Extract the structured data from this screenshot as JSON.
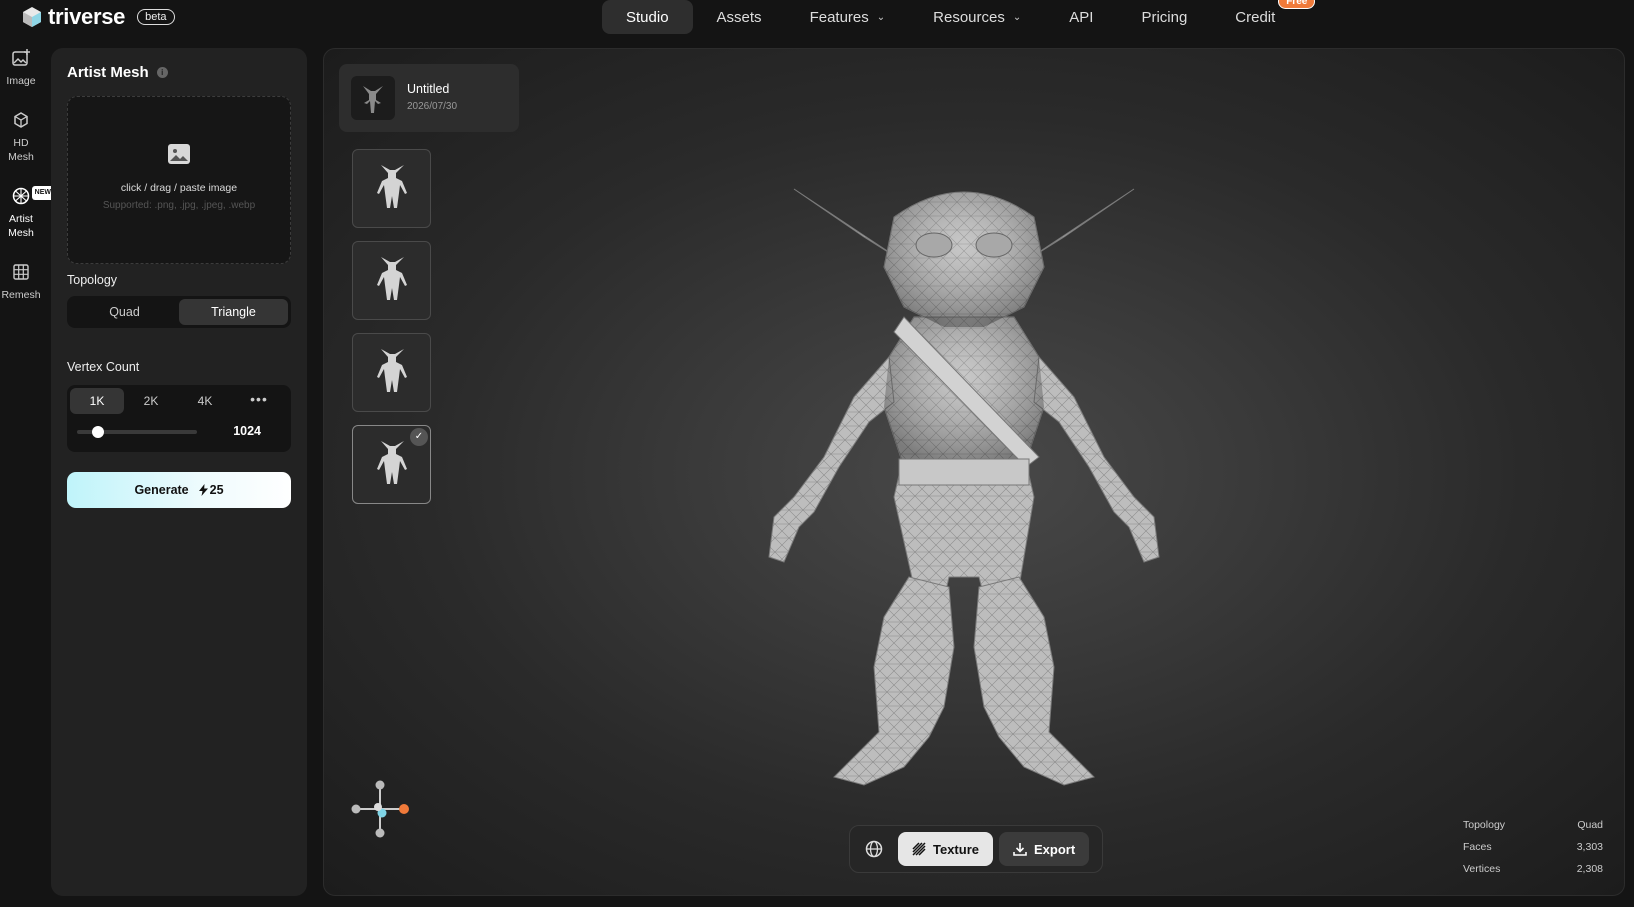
{
  "app": {
    "name": "triverse",
    "badge": "beta"
  },
  "nav": {
    "items": [
      {
        "label": "Studio"
      },
      {
        "label": "Assets"
      },
      {
        "label": "Features"
      },
      {
        "label": "Resources"
      },
      {
        "label": "API"
      },
      {
        "label": "Pricing"
      },
      {
        "label": "Credit"
      }
    ],
    "credit_badge": "Free"
  },
  "leftnav": {
    "items": [
      {
        "label": "Image",
        "icon": "image-plus-icon"
      },
      {
        "label": "HD Mesh",
        "icon": "cube-icon"
      },
      {
        "label": "Artist Mesh",
        "icon": "mesh-sphere-icon",
        "badge": "NEW"
      },
      {
        "label": "Remesh",
        "icon": "grid-icon"
      }
    ]
  },
  "panel": {
    "title": "Artist Mesh",
    "upload_text": "click / drag / paste image",
    "upload_sub": "Supported: .png, .jpg, .jpeg, .webp",
    "topology_label": "Topology",
    "topology_options": [
      "Quad",
      "Triangle"
    ],
    "topology_selected": "Triangle",
    "vertex_label": "Vertex Count",
    "vertex_options": [
      "1K",
      "2K",
      "4K"
    ],
    "vertex_selected": "1K",
    "vertex_value": "1024",
    "generate_label": "Generate",
    "generate_cost": "25"
  },
  "viewer": {
    "card_title": "Untitled",
    "card_date": "2026/07/30",
    "toolbar": {
      "texture": "Texture",
      "export": "Export"
    },
    "stats": [
      {
        "label": "Topology",
        "value": "Quad"
      },
      {
        "label": "Faces",
        "value": "3,303"
      },
      {
        "label": "Vertices",
        "value": "2,308"
      }
    ]
  },
  "colors": {
    "accent": "#f07a3a",
    "generate_start": "#bff4fa",
    "background": "#141414"
  }
}
